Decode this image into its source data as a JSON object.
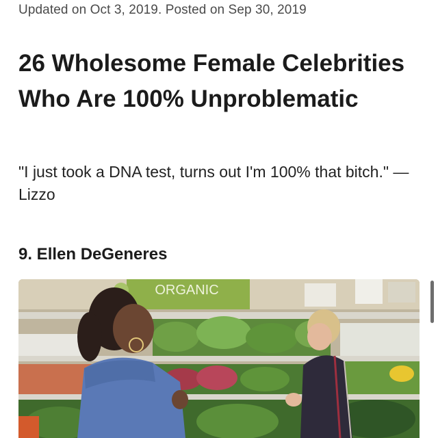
{
  "article": {
    "meta": "Updated on Oct 3, 2019. Posted on Sep 30, 2019",
    "title": "26 Wholesome Female Celebrities Who Are 100% Unproblematic",
    "dek": "\"I just took a DNA test, turns out I'm 100% that bitch.\" —Lizzo"
  },
  "item": {
    "heading": "9. Ellen DeGeneres",
    "sign_text": "ORGANIC"
  },
  "colors": {
    "sign_green": "#8fb04a",
    "shelf_metal": "#d9d6cc",
    "produce_green": "#5d8a3c",
    "sweater_blue": "#5a79b6",
    "dark_jacket": "#2e2a3a"
  }
}
